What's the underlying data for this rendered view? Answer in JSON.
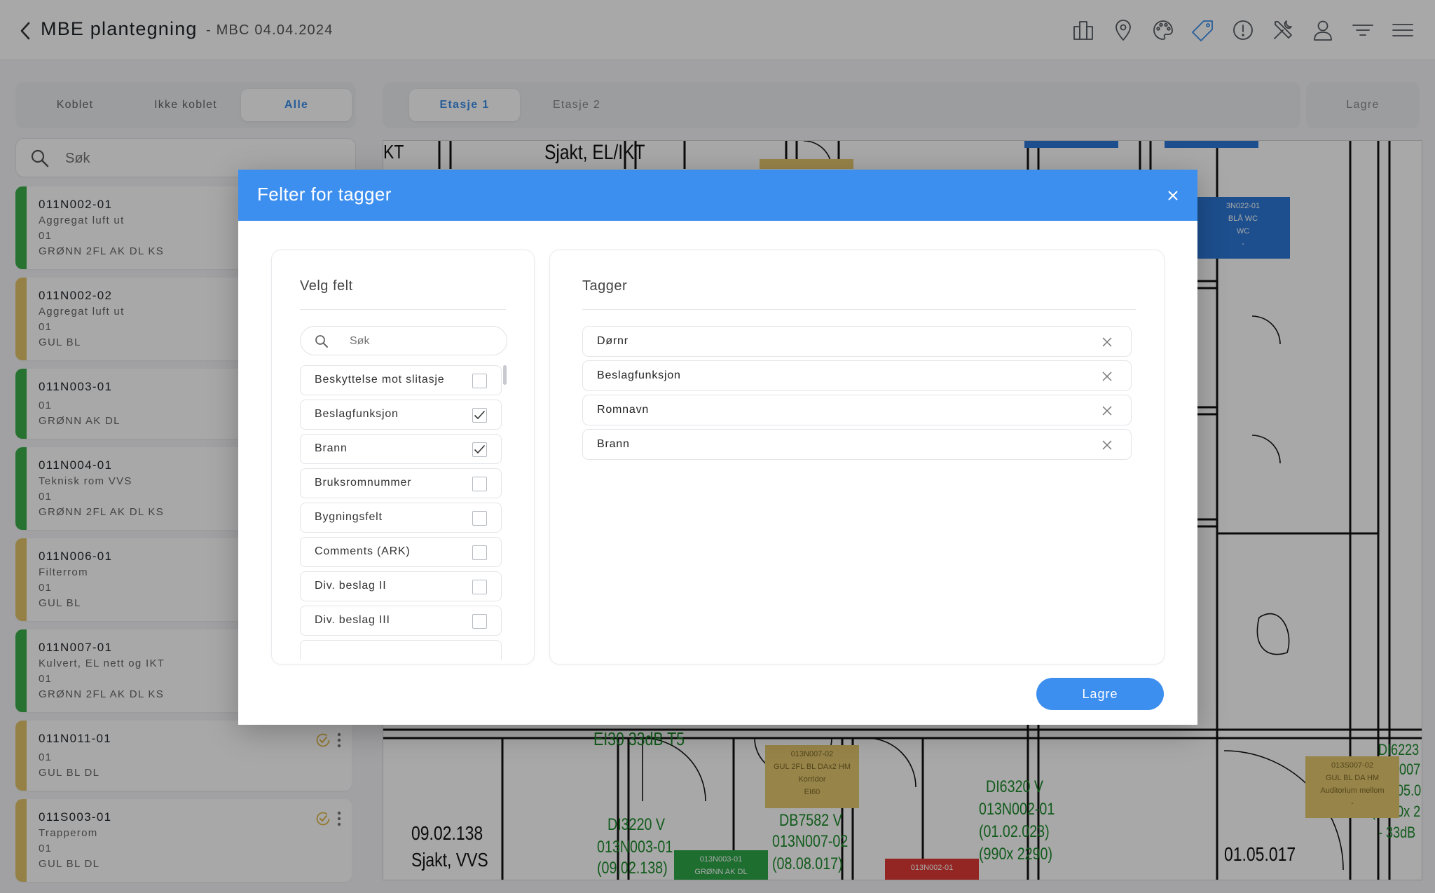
{
  "header": {
    "title": "MBE plantegning",
    "subtitle": "- MBC 04.04.2024",
    "icons": [
      "buildings-icon",
      "location-pin-icon",
      "palette-icon",
      "tag-icon",
      "info-icon",
      "tools-icon",
      "user-icon",
      "filter-icon",
      "menu-icon"
    ],
    "active_icon": "tag-icon",
    "accent_color": "#3a8de8"
  },
  "link_filter": {
    "options": [
      "Koblet",
      "Ikke koblet",
      "Alle"
    ],
    "selected": "Alle"
  },
  "search": {
    "placeholder": "Søk"
  },
  "rooms": [
    {
      "code": "011N002-01",
      "lines": [
        "Aggregat luft ut",
        "01",
        "GRØNN 2FL AK DL KS"
      ],
      "status_color": "#3cae4a"
    },
    {
      "code": "011N002-02",
      "lines": [
        "Aggregat luft ut",
        "01",
        "GUL BL"
      ],
      "status_color": "#e3c46a"
    },
    {
      "code": "011N003-01",
      "lines": [
        "01",
        "GRØNN AK DL"
      ],
      "status_color": "#3cae4a"
    },
    {
      "code": "011N004-01",
      "lines": [
        "Teknisk rom VVS",
        "01",
        "GRØNN 2FL AK DL KS"
      ],
      "status_color": "#3cae4a"
    },
    {
      "code": "011N006-01",
      "lines": [
        "Filterrom",
        "01",
        "GUL BL"
      ],
      "status_color": "#e3c46a"
    },
    {
      "code": "011N007-01",
      "lines": [
        "Kulvert, EL nett og IKT",
        "01",
        "GRØNN 2FL AK DL KS"
      ],
      "status_color": "#3cae4a"
    },
    {
      "code": "011N011-01",
      "lines": [
        "01",
        "GUL BL DL"
      ],
      "status_color": "#e3c46a"
    },
    {
      "code": "011S003-01",
      "lines": [
        "Trapperom",
        "01",
        "GUL BL DL"
      ],
      "status_color": "#e3c46a"
    }
  ],
  "floors": {
    "tabs": [
      "Etasje 1",
      "Etasje 2"
    ],
    "selected": "Etasje 1",
    "save_label": "Lagre"
  },
  "plan": {
    "labels": [
      {
        "text": "Sjakt, EL/IKT",
        "kind": "big"
      },
      {
        "text": "KT",
        "kind": "big"
      },
      {
        "text": "EI30 33dB T5",
        "kind": "green"
      },
      {
        "text": "DI3220 V",
        "kind": "green"
      },
      {
        "text": "013N003-01",
        "kind": "green"
      },
      {
        "text": "(09.02.138)",
        "kind": "green"
      },
      {
        "text": "DB7582 V",
        "kind": "green"
      },
      {
        "text": "013N007-02",
        "kind": "green"
      },
      {
        "text": "(08.08.017)",
        "kind": "green"
      },
      {
        "text": "DI6320 V",
        "kind": "green"
      },
      {
        "text": "013N002-01",
        "kind": "green"
      },
      {
        "text": "(01.02.023)",
        "kind": "green"
      },
      {
        "text": "(990x 2290)",
        "kind": "green"
      },
      {
        "text": "09.02.138",
        "kind": "big"
      },
      {
        "text": "Sjakt, VVS",
        "kind": "big"
      },
      {
        "text": "01.05.017",
        "kind": "big"
      },
      {
        "text": "DI6223",
        "kind": "green"
      },
      {
        "text": "5007",
        "kind": "green"
      },
      {
        "text": "(05.0",
        "kind": "green"
      },
      {
        "text": "(1290x 2",
        "kind": "green"
      },
      {
        "text": "- 33dB",
        "kind": "green"
      }
    ],
    "tags": [
      {
        "lines": [
          "013N007-02",
          "GUL 2FL BL DAx2 HM",
          "Korridor",
          "EI60"
        ],
        "color": "yellow"
      },
      {
        "lines": [
          "013N003-01",
          "GRØNN AK DL"
        ],
        "color": "green"
      },
      {
        "lines": [
          "013N002-01"
        ],
        "color": "red"
      },
      {
        "lines": [
          "013S007-02",
          "GUL BL DA HM",
          "Auditorium mellom",
          "-"
        ],
        "color": "yellow"
      },
      {
        "lines": [
          "3N022-01",
          "BLÅ WC",
          "WC",
          "-"
        ],
        "color": "blue"
      }
    ]
  },
  "modal": {
    "title": "Felter for tagger",
    "left_title": "Velg felt",
    "search_placeholder": "Søk",
    "fields": [
      {
        "label": "Beskyttelse mot slitasje",
        "checked": false
      },
      {
        "label": "Beslagfunksjon",
        "checked": true
      },
      {
        "label": "Brann",
        "checked": true
      },
      {
        "label": "Bruksromnummer",
        "checked": false
      },
      {
        "label": "Bygningsfelt",
        "checked": false
      },
      {
        "label": "Comments (ARK)",
        "checked": false
      },
      {
        "label": "Div. beslag II",
        "checked": false
      },
      {
        "label": "Div. beslag III",
        "checked": false
      }
    ],
    "right_title": "Tagger",
    "tags": [
      "Dørnr",
      "Beslagfunksjon",
      "Romnavn",
      "Brann"
    ],
    "save_label": "Lagre"
  }
}
